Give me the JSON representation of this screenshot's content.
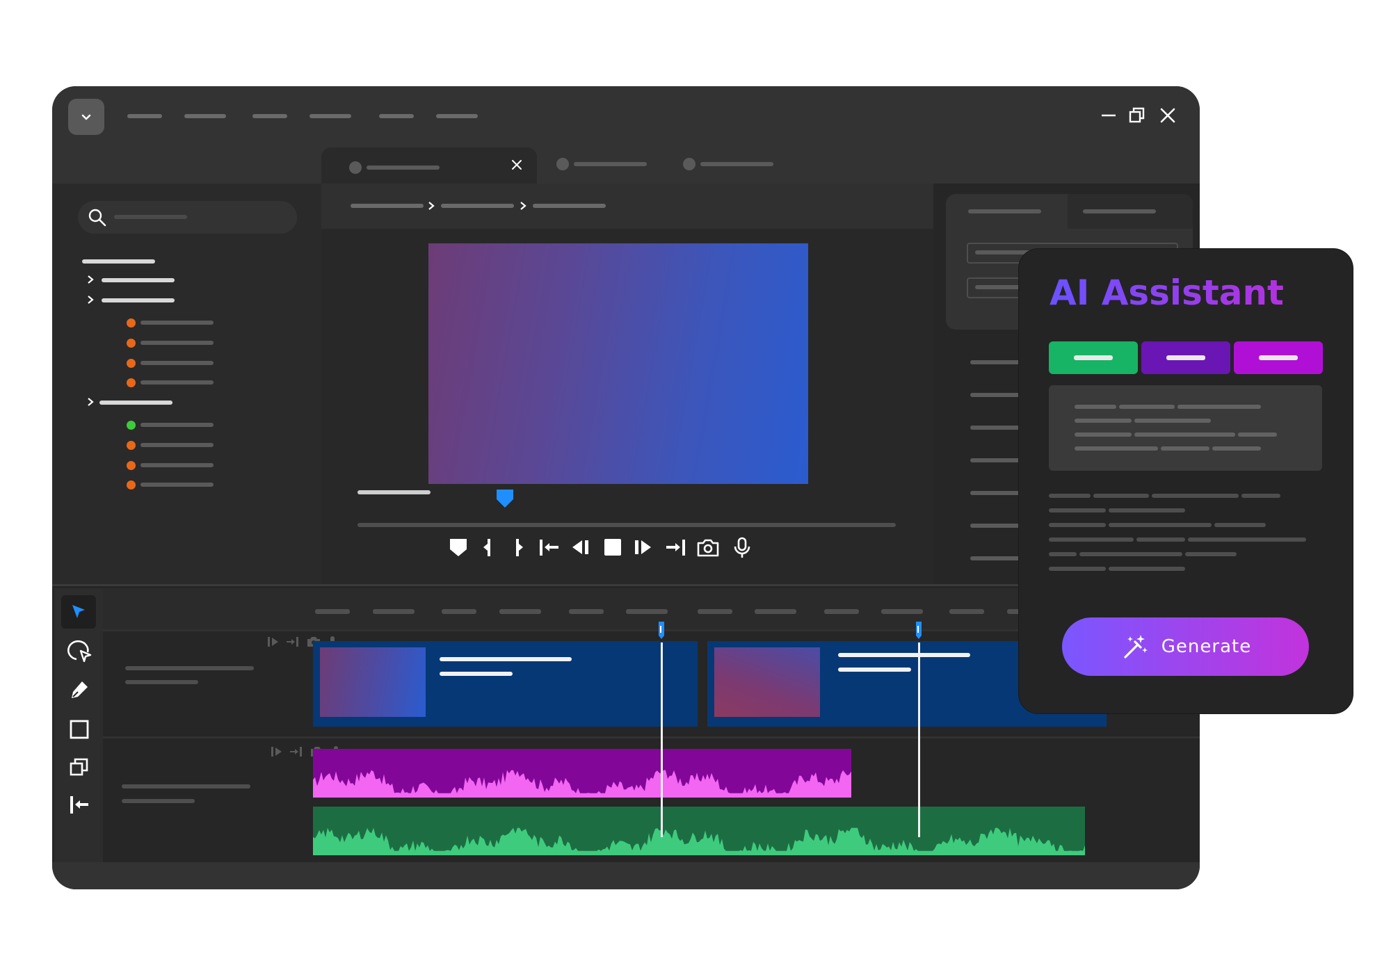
{
  "ai_panel": {
    "title": "AI Assistant",
    "generate_label": "Generate",
    "chip_colors": [
      "#16b464",
      "#6a16b4",
      "#b010d6"
    ]
  },
  "left_panel": {
    "status_dots": [
      "#e8681a",
      "#e8681a",
      "#e8681a",
      "#e8681a",
      "#3ccb3c",
      "#e8681a",
      "#e8681a",
      "#e8681a"
    ]
  },
  "colors": {
    "accent_blue": "#1f8fff",
    "clip_blue": "#063875",
    "audio_purple_bg": "#820799",
    "audio_purple_wave": "#f266f2",
    "audio_green_bg": "#1c6e42",
    "audio_green_wave": "#3fcb7d"
  },
  "icons": {
    "window_menu": "chevron-down-icon",
    "minimize": "minimize-icon",
    "maximize": "restore-icon",
    "close": "close-icon",
    "tools": [
      "select-arrow-icon",
      "lasso-icon",
      "pen-icon",
      "rectangle-icon",
      "layers-icon",
      "align-left-icon"
    ],
    "playback": [
      "marker-icon",
      "mark-in-icon",
      "mark-out-icon",
      "go-to-start-icon",
      "step-back-icon",
      "stop-icon",
      "step-forward-icon",
      "go-to-end-icon",
      "camera-icon",
      "microphone-icon"
    ]
  }
}
